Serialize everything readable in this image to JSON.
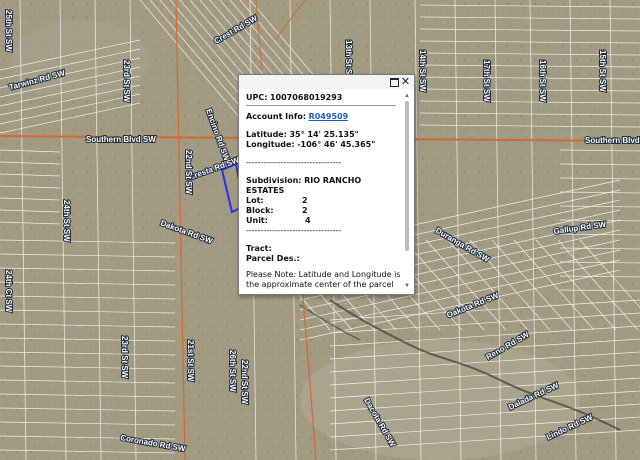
{
  "streets": [
    "Southern Blvd SW",
    "Southern Blvd",
    "Gallup Rd SW",
    "Dakota Rd SW",
    "Oakota Rd SW",
    "Encino Rd SW",
    "Crest Rd SW",
    "Cresta Rd SW",
    "Duranga Rd SW",
    "Reno Rd SW",
    "Dalada Rd SW",
    "Coronado Rd SW",
    "Lindo Rd SW",
    "Tarwinz Rd SW",
    "Dacota Rd SW",
    "22nd St SW",
    "23rd St SW",
    "24th St SW",
    "21st St SW",
    "22nd St SW",
    "17th St SW",
    "16th St SW",
    "15th St SW",
    "14th St SW",
    "13th St SW",
    "23rd St SW",
    "24th Ct SW",
    "25th St SW",
    "26th St SW"
  ],
  "popup": {
    "upc_label": "UPC:",
    "upc_value": "1007068019293",
    "account_label": "Account Info:",
    "account_value": "R049509",
    "latitude_label": "Latitude:",
    "latitude_value": "35° 14' 25.135\"",
    "longitude_label": "Longitude:",
    "longitude_value": "-106° 46' 45.365\"",
    "separator": "---------------------------------",
    "subdivision_label": "Subdivision:",
    "subdivision_value": "RIO RANCHO ESTATES",
    "lot_label": "Lot:",
    "lot_value": "2",
    "block_label": "Block:",
    "block_value": "2",
    "unit_label": "Unit:",
    "unit_value": "4",
    "separator2": "---------------------------------",
    "tract_label": "Tract:",
    "parcel_label": "Parcel Des.:",
    "note": "Please Note: Latitude and Longitude is the approximate center of the parcel shown."
  },
  "colors": {
    "terrain": "#a39a82",
    "parcel_line": "#ffffff",
    "major_road": "#d2692f",
    "selection": "#2233ee",
    "link": "#1b5fbf"
  }
}
